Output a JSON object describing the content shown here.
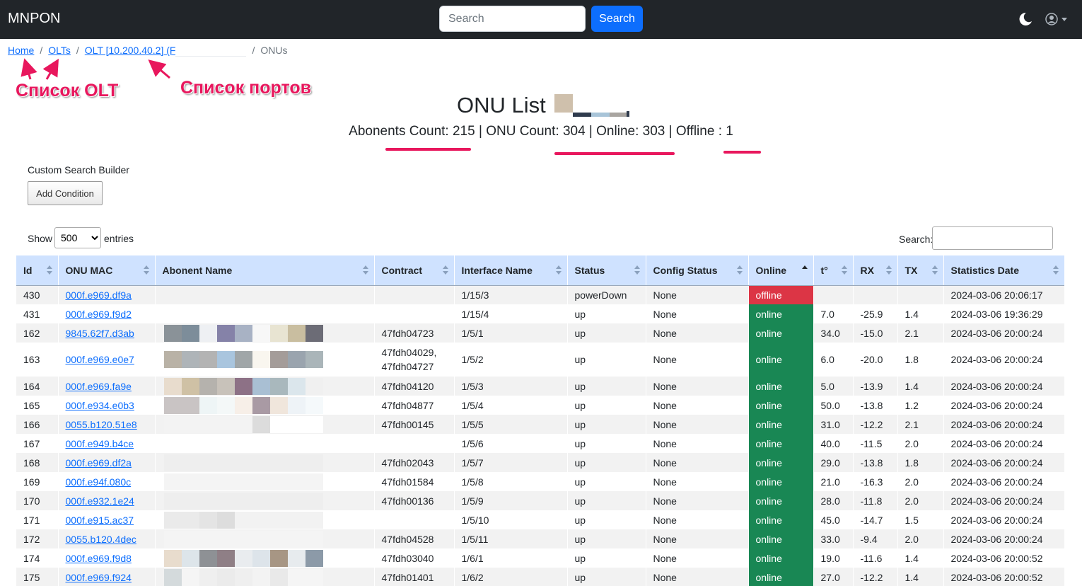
{
  "navbar": {
    "brand": "MNPON",
    "search_placeholder": "Search",
    "search_button": "Search",
    "theme_icon": "moon-icon",
    "user_icon": "user-circle-icon"
  },
  "breadcrumb": {
    "home": "Home",
    "olts": "OLTs",
    "olt": "OLT [10.200.40.2] (F",
    "current": "ONUs"
  },
  "annotations": {
    "olt_list": "Список OLT",
    "ports_list": "Список портов"
  },
  "heading": {
    "title": "ONU List",
    "abonents_label": "Abonents Count: ",
    "abonents_value": "215",
    "onu_label": "ONU Count: ",
    "onu_value": "304",
    "online_label": "Online: ",
    "online_value": "303",
    "offline_label": "Offline : ",
    "offline_value": "1",
    "separator": " | "
  },
  "search_builder": {
    "title": "Custom Search Builder",
    "add_condition": "Add Condition"
  },
  "length_menu": {
    "show": "Show",
    "selected": "500",
    "entries": "entries"
  },
  "table_search": {
    "label": "Search:"
  },
  "columns": [
    "Id",
    "ONU MAC",
    "Abonent Name",
    "Contract",
    "Interface Name",
    "Status",
    "Config Status",
    "Online",
    "t°",
    "RX",
    "TX",
    "Statistics Date"
  ],
  "rows": [
    {
      "id": "430",
      "mac": "000f.e969.df9a",
      "contract": "",
      "iface": "1/15/3",
      "status": "powerDown",
      "config": "None",
      "online": "offline",
      "temp": "",
      "rx": "",
      "tx": "",
      "date": "2024-03-06 20:06:17"
    },
    {
      "id": "431",
      "mac": "000f.e969.f9d2",
      "contract": "",
      "iface": "1/15/4",
      "status": "up",
      "config": "None",
      "online": "online",
      "temp": "7.0",
      "rx": "-25.9",
      "tx": "1.4",
      "date": "2024-03-06 19:36:29"
    },
    {
      "id": "162",
      "mac": "9845.62f7.d3ab",
      "contract": "47fdh04723",
      "iface": "1/5/1",
      "status": "up",
      "config": "None",
      "online": "online",
      "temp": "34.0",
      "rx": "-15.0",
      "tx": "2.1",
      "date": "2024-03-06 20:00:24"
    },
    {
      "id": "163",
      "mac": "000f.e969.e0e7",
      "contract": "47fdh04029, 47fdh04727",
      "iface": "1/5/2",
      "status": "up",
      "config": "None",
      "online": "online",
      "temp": "6.0",
      "rx": "-20.0",
      "tx": "1.8",
      "date": "2024-03-06 20:00:24"
    },
    {
      "id": "164",
      "mac": "000f.e969.fa9e",
      "contract": "47fdh04120",
      "iface": "1/5/3",
      "status": "up",
      "config": "None",
      "online": "online",
      "temp": "5.0",
      "rx": "-13.9",
      "tx": "1.4",
      "date": "2024-03-06 20:00:24"
    },
    {
      "id": "165",
      "mac": "000f.e934.e0b3",
      "contract": "47fdh04877",
      "iface": "1/5/4",
      "status": "up",
      "config": "None",
      "online": "online",
      "temp": "50.0",
      "rx": "-13.8",
      "tx": "1.2",
      "date": "2024-03-06 20:00:24"
    },
    {
      "id": "166",
      "mac": "0055.b120.51e8",
      "contract": "47fdh00145",
      "iface": "1/5/5",
      "status": "up",
      "config": "None",
      "online": "online",
      "temp": "31.0",
      "rx": "-12.2",
      "tx": "2.1",
      "date": "2024-03-06 20:00:24"
    },
    {
      "id": "167",
      "mac": "000f.e949.b4ce",
      "contract": "",
      "iface": "1/5/6",
      "status": "up",
      "config": "None",
      "online": "online",
      "temp": "40.0",
      "rx": "-11.5",
      "tx": "2.0",
      "date": "2024-03-06 20:00:24"
    },
    {
      "id": "168",
      "mac": "000f.e969.df2a",
      "contract": "47fdh02043",
      "iface": "1/5/7",
      "status": "up",
      "config": "None",
      "online": "online",
      "temp": "29.0",
      "rx": "-13.8",
      "tx": "1.8",
      "date": "2024-03-06 20:00:24"
    },
    {
      "id": "169",
      "mac": "000f.e94f.080c",
      "contract": "47fdh01584",
      "iface": "1/5/8",
      "status": "up",
      "config": "None",
      "online": "online",
      "temp": "21.0",
      "rx": "-16.3",
      "tx": "2.0",
      "date": "2024-03-06 20:00:24"
    },
    {
      "id": "170",
      "mac": "000f.e932.1e24",
      "contract": "47fdh00136",
      "iface": "1/5/9",
      "status": "up",
      "config": "None",
      "online": "online",
      "temp": "28.0",
      "rx": "-11.8",
      "tx": "2.0",
      "date": "2024-03-06 20:00:24"
    },
    {
      "id": "171",
      "mac": "000f.e915.ac37",
      "contract": "",
      "iface": "1/5/10",
      "status": "up",
      "config": "None",
      "online": "online",
      "temp": "45.0",
      "rx": "-14.7",
      "tx": "1.5",
      "date": "2024-03-06 20:00:24"
    },
    {
      "id": "172",
      "mac": "0055.b120.4dec",
      "contract": "47fdh04528",
      "iface": "1/5/11",
      "status": "up",
      "config": "None",
      "online": "online",
      "temp": "33.0",
      "rx": "-9.4",
      "tx": "2.0",
      "date": "2024-03-06 20:00:24"
    },
    {
      "id": "174",
      "mac": "000f.e969.f9d8",
      "contract": "47fdh03040",
      "iface": "1/6/1",
      "status": "up",
      "config": "None",
      "online": "online",
      "temp": "19.0",
      "rx": "-11.6",
      "tx": "1.4",
      "date": "2024-03-06 20:00:52"
    },
    {
      "id": "175",
      "mac": "000f.e969.f924",
      "contract": "47fdh01401",
      "iface": "1/6/2",
      "status": "up",
      "config": "None",
      "online": "online",
      "temp": "27.0",
      "rx": "-12.2",
      "tx": "1.4",
      "date": "2024-03-06 20:00:52"
    }
  ],
  "colors": {
    "navbar": "#212529",
    "primary": "#0d6efd",
    "online": "#198754",
    "offline": "#dc3545",
    "header_bg": "#cfe2ff",
    "annotation": "#e8175d"
  }
}
